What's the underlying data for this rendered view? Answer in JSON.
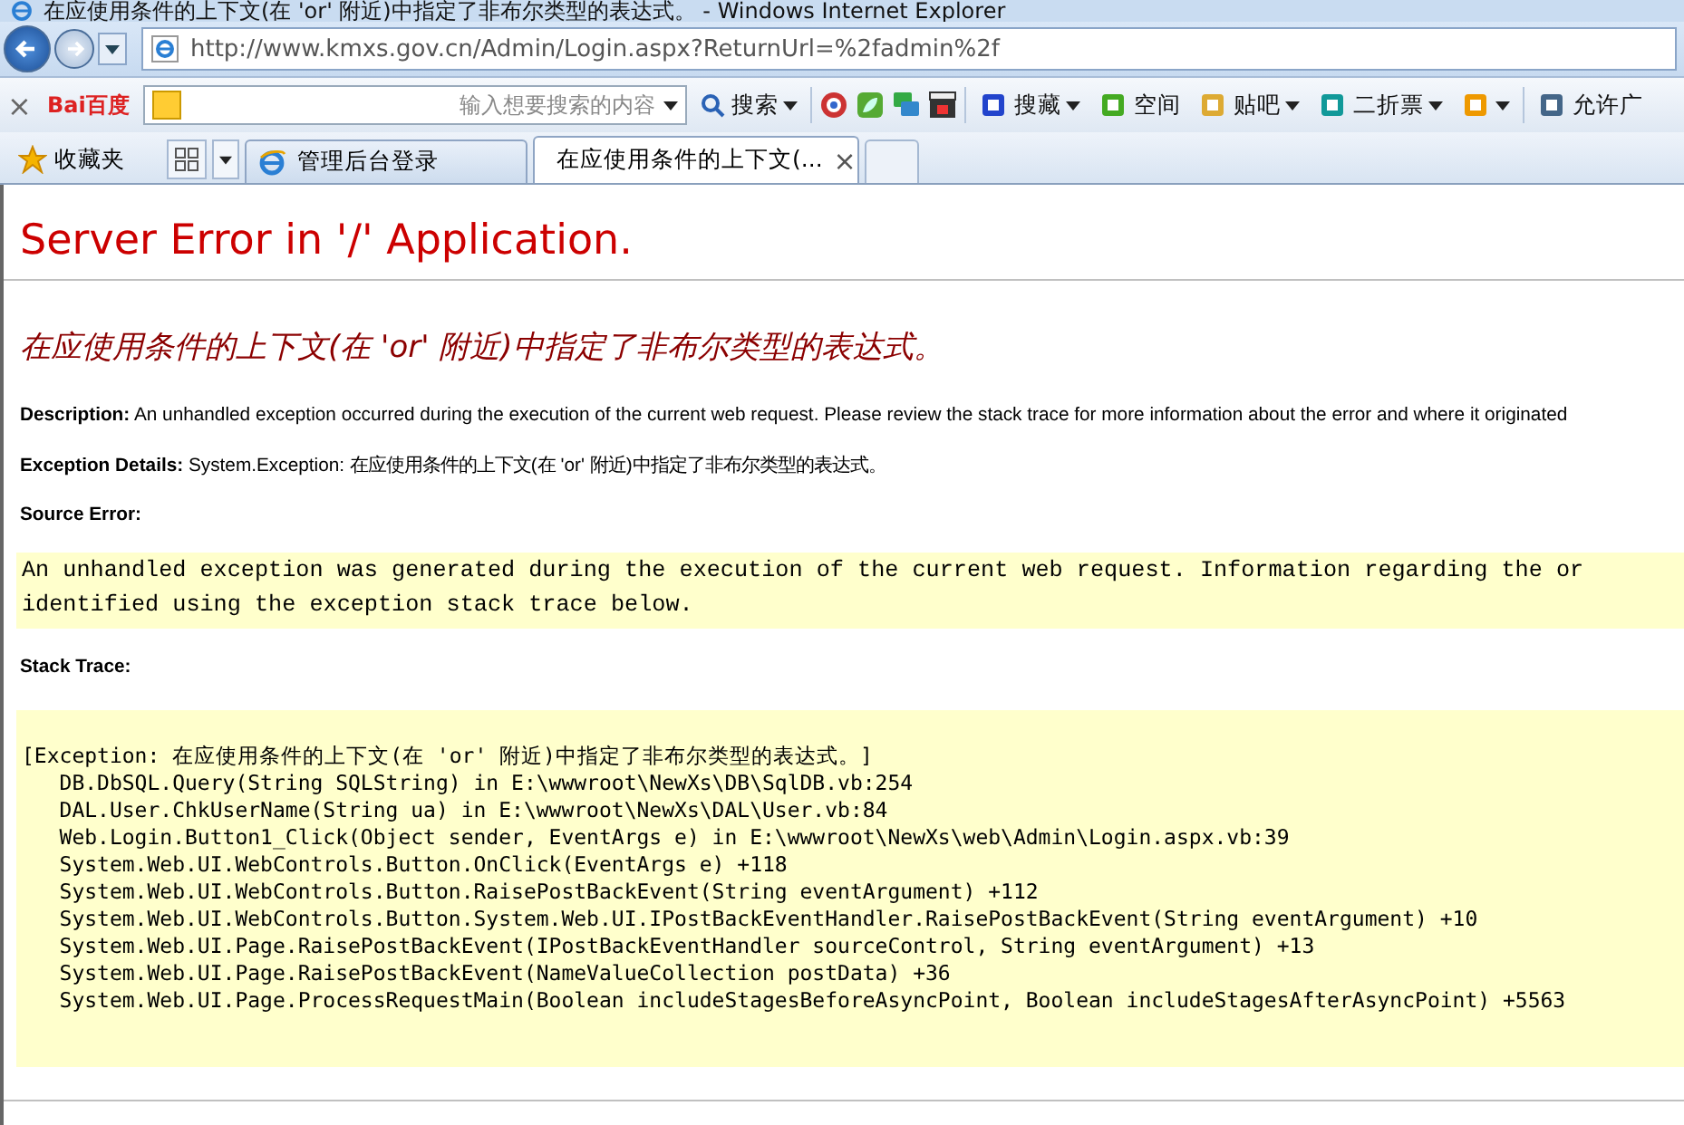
{
  "window": {
    "title": "在应使用条件的上下文(在 'or' 附近)中指定了非布尔类型的表达式。 - Windows Internet Explorer"
  },
  "address_bar": {
    "url": "http://www.kmxs.gov.cn/Admin/Login.aspx?ReturnUrl=%2fadmin%2f"
  },
  "baidu_toolbar": {
    "close": "×",
    "logo": "Bai百度",
    "search_placeholder": "输入想要搜索的内容",
    "search_button": "搜索",
    "items": [
      {
        "label": "搜藏",
        "dropdown": true
      },
      {
        "label": "空间",
        "dropdown": false
      },
      {
        "label": "贴吧",
        "dropdown": true
      },
      {
        "label": "二折票",
        "dropdown": true
      },
      {
        "dropdown": true
      },
      {
        "label": "允许广",
        "dropdown": false
      }
    ]
  },
  "favorites_bar": {
    "label": "收藏夹"
  },
  "tabs": [
    {
      "label": "管理后台登录",
      "selected": false
    },
    {
      "label": "在应使用条件的上下文(...",
      "selected": true,
      "close": "×"
    }
  ],
  "page": {
    "title": "Server Error in '/' Application.",
    "subtitle": "在应使用条件的上下文(在 'or' 附近)中指定了非布尔类型的表达式。",
    "sections": [
      {
        "kind": "text",
        "label": "Description:",
        "text": "An unhandled exception occurred during the execution of the current web request. Please review the stack trace for more information about the error and where it originated"
      },
      {
        "kind": "text",
        "label": "Exception Details:",
        "text": "System.Exception: 在应使用条件的上下文(在  'or' 附近)中指定了非布尔类型的表达式。"
      },
      {
        "kind": "code",
        "label": "Source Error:",
        "lines": [
          "An unhandled exception was generated during the execution of the current web request. Information regarding the or",
          "identified using the exception stack trace below."
        ]
      },
      {
        "kind": "trace",
        "label": "Stack Trace:",
        "lines": [
          "[Exception: 在应使用条件的上下文(在 'or' 附近)中指定了非布尔类型的表达式。]",
          "   DB.DbSQL.Query(String SQLString) in E:\\wwwroot\\NewXs\\DB\\SqlDB.vb:254",
          "   DAL.User.ChkUserName(String ua) in E:\\wwwroot\\NewXs\\DAL\\User.vb:84",
          "   Web.Login.Button1_Click(Object sender, EventArgs e) in E:\\wwwroot\\NewXs\\web\\Admin\\Login.aspx.vb:39",
          "   System.Web.UI.WebControls.Button.OnClick(EventArgs e) +118",
          "   System.Web.UI.WebControls.Button.RaisePostBackEvent(String eventArgument) +112",
          "   System.Web.UI.WebControls.Button.System.Web.UI.IPostBackEventHandler.RaisePostBackEvent(String eventArgument) +10",
          "   System.Web.UI.Page.RaisePostBackEvent(IPostBackEventHandler sourceControl, String eventArgument) +13",
          "   System.Web.UI.Page.RaisePostBackEvent(NameValueCollection postData) +36",
          "   System.Web.UI.Page.ProcessRequestMain(Boolean includeStagesBeforeAsyncPoint, Boolean includeStagesAfterAsyncPoint) +5563"
        ]
      }
    ]
  }
}
